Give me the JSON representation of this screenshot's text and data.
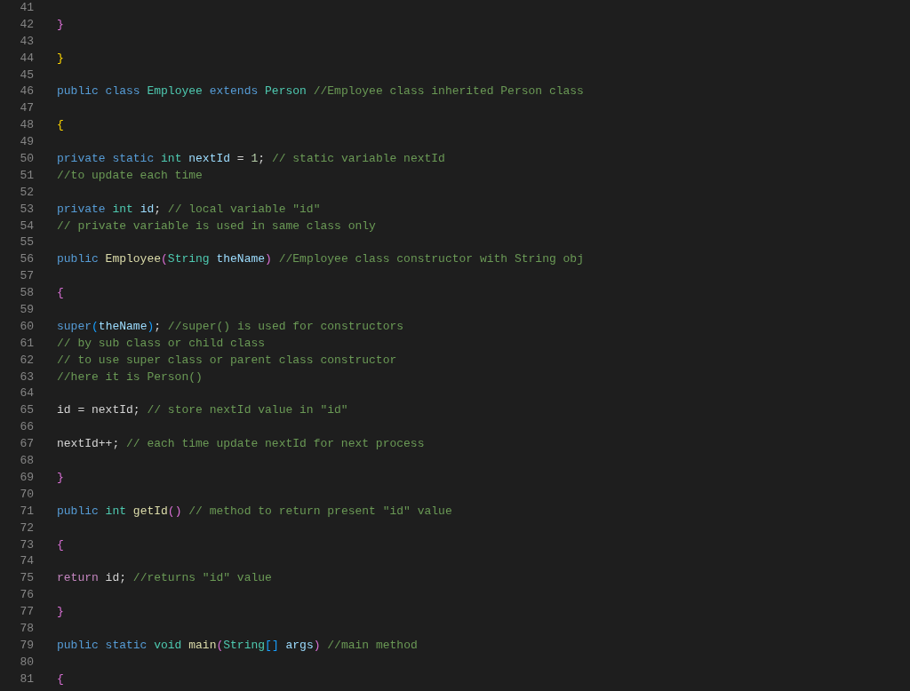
{
  "editor": {
    "lines": [
      {
        "number": "41"
      },
      {
        "number": "42",
        "tokens": [
          {
            "kind": "bracket2",
            "text": "}"
          }
        ]
      },
      {
        "number": "43"
      },
      {
        "number": "44",
        "tokens": [
          {
            "kind": "bracket1",
            "text": "}"
          }
        ]
      },
      {
        "number": "45"
      },
      {
        "number": "46",
        "tokens": [
          {
            "kind": "keyword",
            "text": "public class "
          },
          {
            "kind": "type",
            "text": "Employee"
          },
          {
            "kind": "keyword",
            "text": " extends "
          },
          {
            "kind": "type",
            "text": "Person"
          },
          {
            "kind": "comment",
            "text": " //Employee class inherited Person class"
          }
        ]
      },
      {
        "number": "47"
      },
      {
        "number": "48",
        "tokens": [
          {
            "kind": "bracket1",
            "text": "{"
          }
        ]
      },
      {
        "number": "49"
      },
      {
        "number": "50",
        "tokens": [
          {
            "kind": "keyword",
            "text": "private static "
          },
          {
            "kind": "type",
            "text": "int"
          },
          {
            "kind": "variable",
            "text": " nextId"
          },
          {
            "kind": "plain",
            "text": " = "
          },
          {
            "kind": "number",
            "text": "1"
          },
          {
            "kind": "plain",
            "text": ";"
          },
          {
            "kind": "comment",
            "text": " // static variable nextId"
          }
        ]
      },
      {
        "number": "51",
        "tokens": [
          {
            "kind": "comment",
            "text": "//to update each time"
          }
        ]
      },
      {
        "number": "52"
      },
      {
        "number": "53",
        "tokens": [
          {
            "kind": "keyword",
            "text": "private "
          },
          {
            "kind": "type",
            "text": "int"
          },
          {
            "kind": "variable",
            "text": " id"
          },
          {
            "kind": "plain",
            "text": ";"
          },
          {
            "kind": "comment",
            "text": " // local variable \"id\""
          }
        ]
      },
      {
        "number": "54",
        "tokens": [
          {
            "kind": "comment",
            "text": "// private variable is used in same class only"
          }
        ]
      },
      {
        "number": "55"
      },
      {
        "number": "56",
        "tokens": [
          {
            "kind": "keyword",
            "text": "public "
          },
          {
            "kind": "function",
            "text": "Employee"
          },
          {
            "kind": "bracket2",
            "text": "("
          },
          {
            "kind": "type",
            "text": "String"
          },
          {
            "kind": "variable",
            "text": " theName"
          },
          {
            "kind": "bracket2",
            "text": ")"
          },
          {
            "kind": "comment",
            "text": " //Employee class constructor with String obj"
          }
        ]
      },
      {
        "number": "57"
      },
      {
        "number": "58",
        "tokens": [
          {
            "kind": "bracket2",
            "text": "{"
          }
        ]
      },
      {
        "number": "59"
      },
      {
        "number": "60",
        "tokens": [
          {
            "kind": "keyword",
            "text": "super"
          },
          {
            "kind": "bracket3",
            "text": "("
          },
          {
            "kind": "variable",
            "text": "theName"
          },
          {
            "kind": "bracket3",
            "text": ")"
          },
          {
            "kind": "plain",
            "text": ";"
          },
          {
            "kind": "comment",
            "text": " //super() is used for constructors"
          }
        ]
      },
      {
        "number": "61",
        "tokens": [
          {
            "kind": "comment",
            "text": "// by sub class or child class"
          }
        ]
      },
      {
        "number": "62",
        "tokens": [
          {
            "kind": "comment",
            "text": "// to use super class or parent class constructor"
          }
        ]
      },
      {
        "number": "63",
        "tokens": [
          {
            "kind": "comment",
            "text": "//here it is Person()"
          }
        ]
      },
      {
        "number": "64"
      },
      {
        "number": "65",
        "tokens": [
          {
            "kind": "plain",
            "text": "id = nextId;"
          },
          {
            "kind": "comment",
            "text": " // store nextId value in \"id\""
          }
        ]
      },
      {
        "number": "66"
      },
      {
        "number": "67",
        "tokens": [
          {
            "kind": "plain",
            "text": "nextId++;"
          },
          {
            "kind": "comment",
            "text": " // each time update nextId for next process"
          }
        ]
      },
      {
        "number": "68"
      },
      {
        "number": "69",
        "tokens": [
          {
            "kind": "bracket2",
            "text": "}"
          }
        ]
      },
      {
        "number": "70"
      },
      {
        "number": "71",
        "tokens": [
          {
            "kind": "keyword",
            "text": "public "
          },
          {
            "kind": "type",
            "text": "int "
          },
          {
            "kind": "function",
            "text": "getId"
          },
          {
            "kind": "bracket2",
            "text": "()"
          },
          {
            "kind": "comment",
            "text": " // method to return present \"id\" value"
          }
        ]
      },
      {
        "number": "72"
      },
      {
        "number": "73",
        "tokens": [
          {
            "kind": "bracket2",
            "text": "{"
          }
        ]
      },
      {
        "number": "74"
      },
      {
        "number": "75",
        "tokens": [
          {
            "kind": "control",
            "text": "return"
          },
          {
            "kind": "plain",
            "text": " id;"
          },
          {
            "kind": "comment",
            "text": " //returns \"id\" value"
          }
        ]
      },
      {
        "number": "76"
      },
      {
        "number": "77",
        "tokens": [
          {
            "kind": "bracket2",
            "text": "}"
          }
        ]
      },
      {
        "number": "78"
      },
      {
        "number": "79",
        "tokens": [
          {
            "kind": "keyword",
            "text": "public static "
          },
          {
            "kind": "type",
            "text": "void "
          },
          {
            "kind": "function",
            "text": "main"
          },
          {
            "kind": "bracket2",
            "text": "("
          },
          {
            "kind": "type",
            "text": "String"
          },
          {
            "kind": "bracket3",
            "text": "[]"
          },
          {
            "kind": "variable",
            "text": " args"
          },
          {
            "kind": "bracket2",
            "text": ")"
          },
          {
            "kind": "comment",
            "text": " //main method"
          }
        ]
      },
      {
        "number": "80"
      },
      {
        "number": "81",
        "tokens": [
          {
            "kind": "bracket2",
            "text": "{"
          }
        ]
      }
    ]
  }
}
